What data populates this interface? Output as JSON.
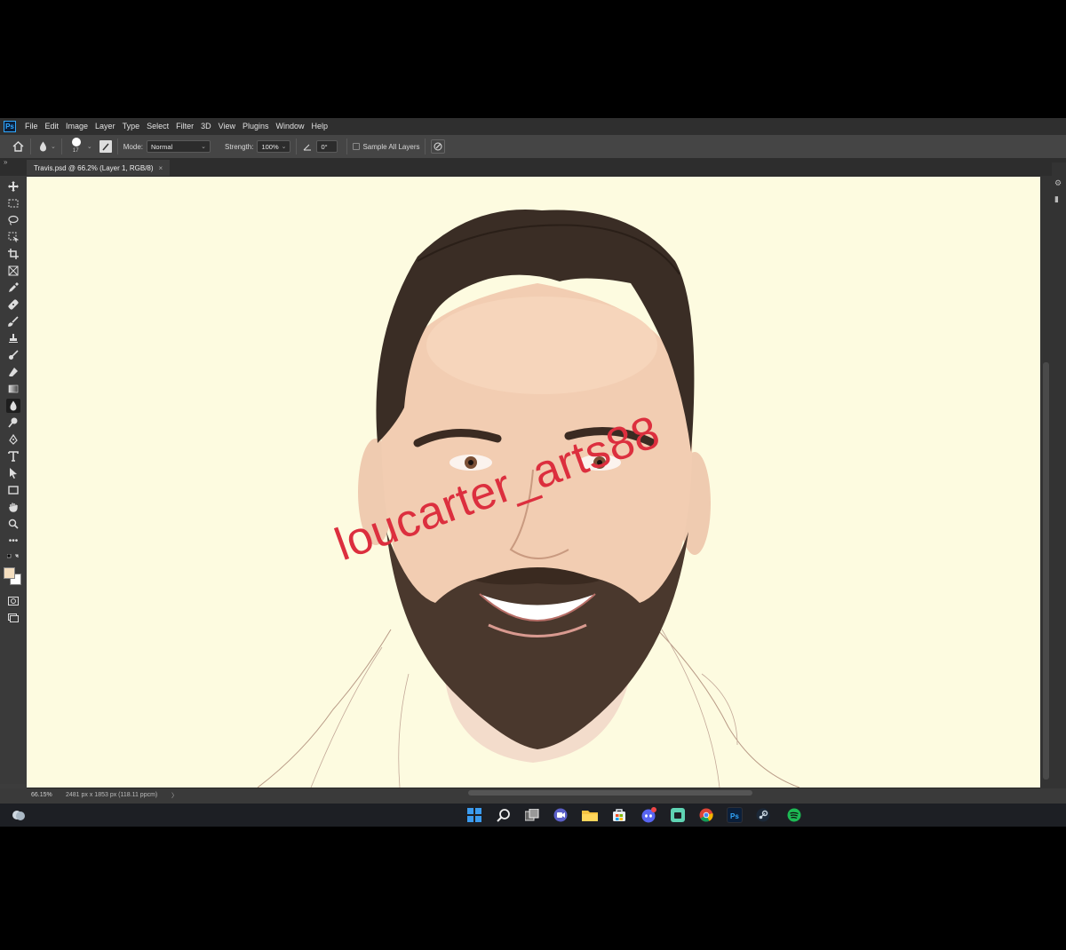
{
  "app": {
    "logo_text": "Ps",
    "menu": [
      "File",
      "Edit",
      "Image",
      "Layer",
      "Type",
      "Select",
      "Filter",
      "3D",
      "View",
      "Plugins",
      "Window",
      "Help"
    ]
  },
  "options": {
    "brush_size": "17",
    "mode_label": "Mode:",
    "mode_value": "Normal",
    "strength_label": "Strength:",
    "strength_value": "100%",
    "angle_value": "0°",
    "sample_all_layers_label": "Sample All Layers"
  },
  "document": {
    "tab_title": "Travis.psd @ 66.2% (Layer 1, RGB/8)",
    "close_glyph": "×",
    "watermark": "loucarter_arts88",
    "canvas_color": "#fdfbe0"
  },
  "status": {
    "zoom": "66.15%",
    "dimensions": "2481 px x 1853 px (118.11 ppcm)",
    "arrow": "〉"
  },
  "colors": {
    "foreground": "#f5dfc0",
    "background": "#ffffff",
    "accent": "#31a8ff",
    "watermark": "#dc2f3e"
  },
  "tools": [
    "move-tool",
    "marquee-tool",
    "lasso-tool",
    "object-select-tool",
    "crop-tool",
    "frame-tool",
    "eyedropper-tool",
    "healing-tool",
    "brush-tool",
    "clone-stamp-tool",
    "history-brush-tool",
    "eraser-tool",
    "gradient-tool",
    "blur-tool",
    "dodge-tool",
    "pen-tool",
    "type-tool",
    "path-select-tool",
    "rectangle-tool",
    "hand-tool",
    "zoom-tool",
    "more-tools"
  ],
  "taskbar": [
    "windows-start",
    "search",
    "task-view",
    "teams-chat",
    "file-explorer",
    "microsoft-store",
    "discord",
    "app-green",
    "chrome",
    "photoshop",
    "steam",
    "spotify"
  ]
}
